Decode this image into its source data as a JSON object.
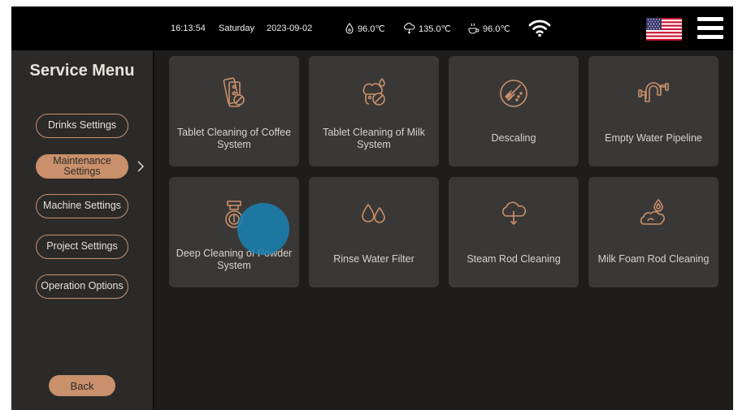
{
  "status_bar": {
    "time": "16:13:54",
    "day": "Saturday",
    "date": "2023-09-02",
    "temp_water": "96.0℃",
    "temp_steam": "135.0℃",
    "temp_coffee": "96.0℃",
    "wifi_icon": "wifi-icon",
    "language_flag": "us-flag-icon",
    "menu_icon": "hamburger-menu-icon"
  },
  "sidebar": {
    "title": "Service Menu",
    "items": [
      {
        "label": "Drinks Settings",
        "active": false
      },
      {
        "label": "Maintenance Settings",
        "active": true
      },
      {
        "label": "Machine Settings",
        "active": false
      },
      {
        "label": "Project Settings",
        "active": false
      },
      {
        "label": "Operation Options",
        "active": false
      }
    ],
    "back_label": "Back"
  },
  "tiles": [
    {
      "label": "Tablet Cleaning of Coffee System",
      "icon": "tablet-coffee-cleaning-icon"
    },
    {
      "label": "Tablet Cleaning of Milk System",
      "icon": "tablet-milk-cleaning-icon"
    },
    {
      "label": "Descaling",
      "icon": "descaling-icon"
    },
    {
      "label": "Empty Water Pipeline",
      "icon": "pipeline-icon"
    },
    {
      "label": "Deep Cleaning of Powder System",
      "icon": "powder-system-icon"
    },
    {
      "label": "Rinse Water Filter",
      "icon": "water-drops-icon"
    },
    {
      "label": "Steam Rod Cleaning",
      "icon": "steam-rod-icon"
    },
    {
      "label": "Milk Foam Rod Cleaning",
      "icon": "milk-foam-icon"
    }
  ],
  "colors": {
    "accent": "#c9906b",
    "tile_bg": "#3a3836",
    "sidebar_bg": "#2b2a29",
    "main_bg": "#1e1d1c",
    "topbar_bg": "#000000",
    "touch_indicator": "#1a7fb0"
  }
}
